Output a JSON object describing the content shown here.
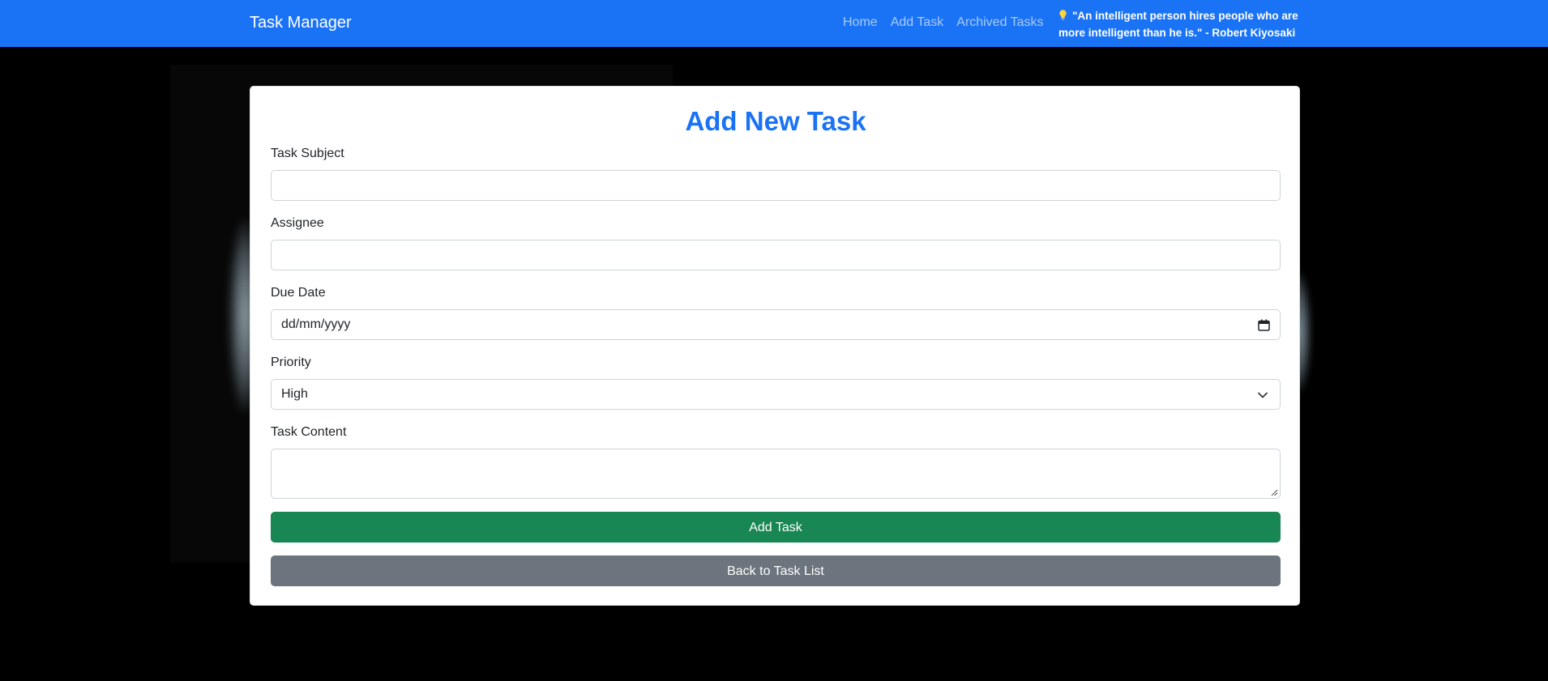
{
  "navbar": {
    "brand": "Task Manager",
    "links": [
      "Home",
      "Add Task",
      "Archived Tasks"
    ],
    "quote": "\"An intelligent person hires people who are more intelligent than he is.\" - Robert Kiyosaki",
    "quote_icon": "lightbulb-icon"
  },
  "form": {
    "title": "Add New Task",
    "subject_label": "Task Subject",
    "subject_value": "",
    "assignee_label": "Assignee",
    "assignee_value": "",
    "due_date_label": "Due Date",
    "due_date_placeholder": "dd/mm/yyyy",
    "priority_label": "Priority",
    "priority_selected": "High",
    "content_label": "Task Content",
    "content_value": "",
    "submit_label": "Add Task",
    "back_label": "Back to Task List"
  },
  "colors": {
    "navbar": "#1a73f5",
    "title": "#1a73f5",
    "submit_button": "#198754",
    "back_button": "#6c757d",
    "page_background": "#000000"
  }
}
